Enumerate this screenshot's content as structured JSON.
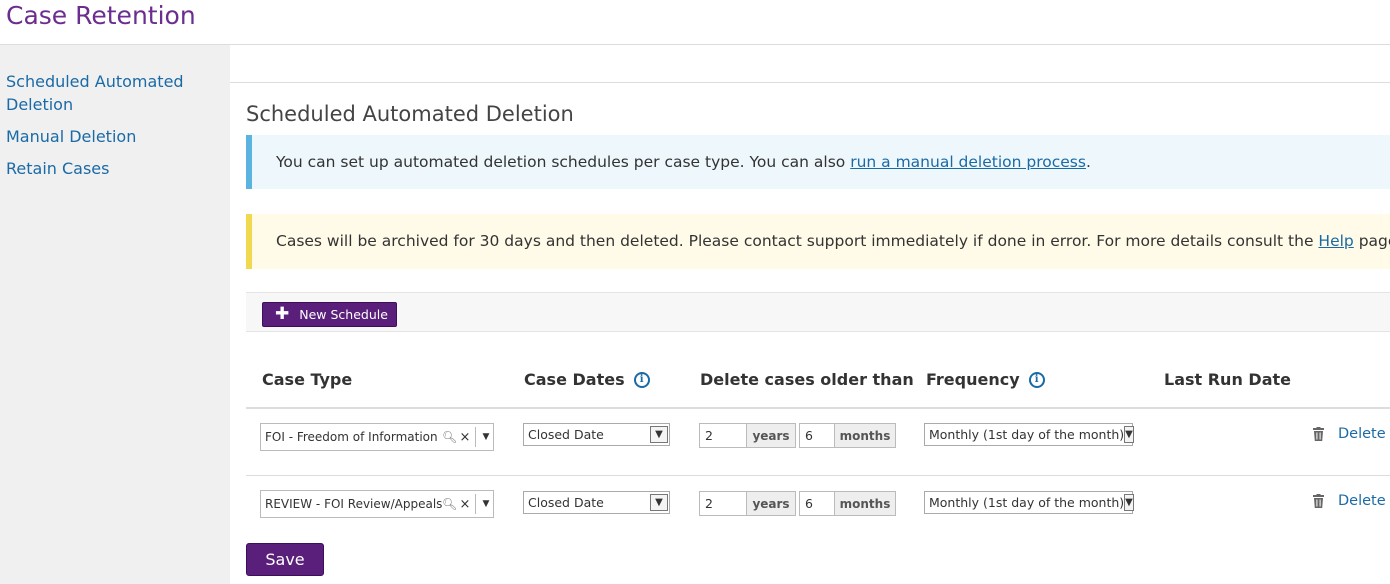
{
  "page": {
    "title": "Case Retention"
  },
  "sidebar": {
    "items": [
      {
        "label": "Scheduled Automated Deletion"
      },
      {
        "label": "Manual Deletion"
      },
      {
        "label": "Retain Cases"
      }
    ]
  },
  "main": {
    "section_title": "Scheduled Automated Deletion",
    "info_alert": {
      "before": "You can set up automated deletion schedules per case type. You can also ",
      "link": "run a manual deletion process",
      "after": "."
    },
    "warn_alert": {
      "before": "Cases will be archived for 30 days and then deleted. Please contact support immediately if done in error. For more details consult the ",
      "link": "Help",
      "after": " page."
    },
    "new_schedule_label": "New Schedule",
    "columns": [
      "Case Type",
      "Case Dates",
      "Delete cases older than",
      "Frequency",
      "Last Run Date"
    ],
    "years_label": "years",
    "months_label": "months",
    "delete_label": "Delete",
    "rows": [
      {
        "case_type": "FOI - Freedom of Information",
        "case_dates": "Closed Date",
        "years": "2",
        "months": "6",
        "frequency": "Monthly (1st day of the month)",
        "last_run": ""
      },
      {
        "case_type": "REVIEW - FOI Review/Appeals",
        "case_dates": "Closed Date",
        "years": "2",
        "months": "6",
        "frequency": "Monthly (1st day of the month)",
        "last_run": ""
      }
    ],
    "save_label": "Save"
  },
  "colors": {
    "brand": "#6b2d8f",
    "button": "#5a1f7a",
    "link": "#1a6aa6",
    "info_border": "#5bb3e0",
    "warn_border": "#f0d94e"
  }
}
